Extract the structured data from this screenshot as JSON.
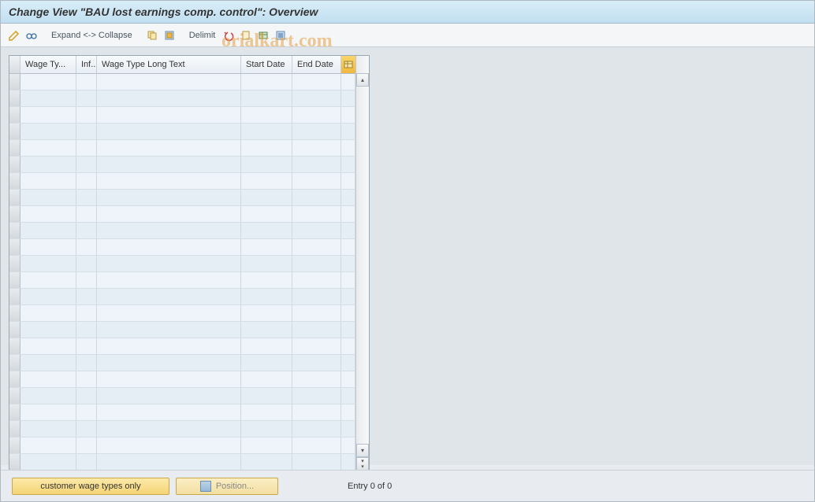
{
  "title": "Change View \"BAU lost earnings comp. control\": Overview",
  "toolbar": {
    "expand_label": "Expand <-> Collapse",
    "delimit_label": "Delimit"
  },
  "table": {
    "columns": {
      "wage_type": "Wage Ty...",
      "inf": "Inf...",
      "long_text": "Wage Type Long Text",
      "start_date": "Start Date",
      "end_date": "End Date"
    },
    "row_count": 24
  },
  "footer": {
    "customer_btn": "customer wage types only",
    "position_btn": "Position...",
    "status": "Entry 0 of 0"
  },
  "watermark": "orialkart.com"
}
